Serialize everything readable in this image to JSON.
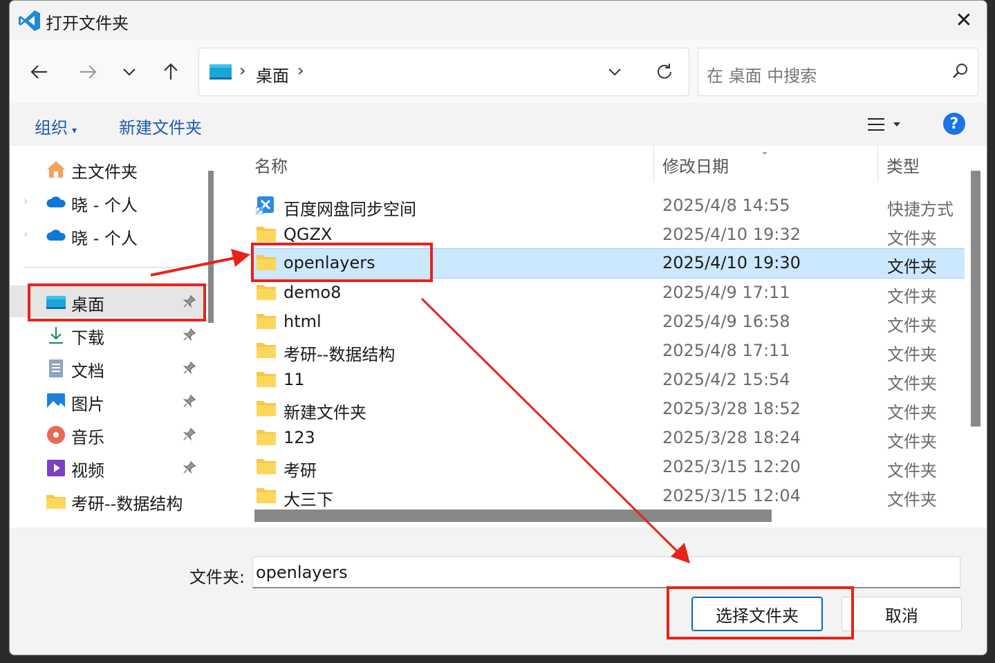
{
  "dialog": {
    "title": "打开文件夹",
    "close_symbol": "✕"
  },
  "address": {
    "crumb_sep": "›",
    "crumb": "桌面",
    "crumb_trailing_sep": "›"
  },
  "search": {
    "placeholder": "在 桌面 中搜索"
  },
  "toolbar": {
    "organize_label": "组织",
    "organize_caret": "▾",
    "new_folder_label": "新建文件夹",
    "help_label": "?"
  },
  "sidebar": {
    "items": [
      {
        "label": "主文件夹",
        "icon": "home-icon"
      },
      {
        "label": "晓 - 个人",
        "icon": "onedrive-icon"
      },
      {
        "label": "晓 - 个人",
        "icon": "onedrive-icon"
      },
      {
        "label": "桌面",
        "icon": "desktop-icon",
        "pinned": true
      },
      {
        "label": "下载",
        "icon": "download-icon",
        "pinned": true
      },
      {
        "label": "文档",
        "icon": "document-icon",
        "pinned": true
      },
      {
        "label": "图片",
        "icon": "picture-icon",
        "pinned": true
      },
      {
        "label": "音乐",
        "icon": "music-icon",
        "pinned": true
      },
      {
        "label": "视频",
        "icon": "video-icon",
        "pinned": true
      },
      {
        "label": "考研--数据结构",
        "icon": "folder-icon"
      }
    ],
    "selected": "桌面"
  },
  "columns": {
    "name": "名称",
    "modified": "修改日期",
    "type": "类型"
  },
  "files": [
    {
      "name": "百度网盘同步空间",
      "date": "2025/4/8 14:55",
      "type": "快捷方式",
      "icon": "shortcut-icon"
    },
    {
      "name": "QGZX",
      "date": "2025/4/10 19:32",
      "type": "文件夹",
      "icon": "folder-icon"
    },
    {
      "name": "openlayers",
      "date": "2025/4/10 19:30",
      "type": "文件夹",
      "icon": "folder-icon",
      "selected": true
    },
    {
      "name": "demo8",
      "date": "2025/4/9 17:11",
      "type": "文件夹",
      "icon": "folder-icon"
    },
    {
      "name": "html",
      "date": "2025/4/9 16:58",
      "type": "文件夹",
      "icon": "folder-icon"
    },
    {
      "name": "考研--数据结构",
      "date": "2025/4/8 17:11",
      "type": "文件夹",
      "icon": "folder-icon"
    },
    {
      "name": "11",
      "date": "2025/4/2 15:54",
      "type": "文件夹",
      "icon": "folder-icon"
    },
    {
      "name": "新建文件夹",
      "date": "2025/3/28 18:52",
      "type": "文件夹",
      "icon": "folder-icon"
    },
    {
      "name": "123",
      "date": "2025/3/28 18:24",
      "type": "文件夹",
      "icon": "folder-icon"
    },
    {
      "name": "考研",
      "date": "2025/3/15 12:20",
      "type": "文件夹",
      "icon": "folder-icon"
    },
    {
      "name": "大三下",
      "date": "2025/3/15 12:04",
      "type": "文件夹",
      "icon": "folder-icon"
    }
  ],
  "footer": {
    "folder_label": "文件夹:",
    "folder_value": "openlayers",
    "select_button": "选择文件夹",
    "cancel_button": "取消"
  },
  "colors": {
    "annotation": "#e8231a",
    "selection": "#cce8ff",
    "accent": "#0067c0"
  }
}
